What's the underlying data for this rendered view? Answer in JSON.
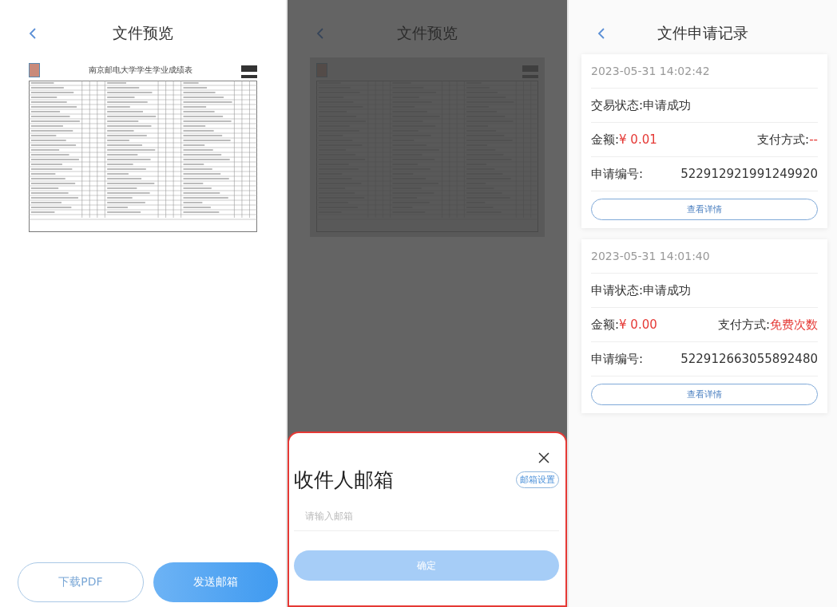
{
  "preview_screen": {
    "title": "文件预览",
    "document_title": "南京邮电大学学生学业成绩表",
    "buttons": [
      {
        "label": "下载PDF",
        "kind": "outline"
      },
      {
        "label": "发送邮箱",
        "kind": "primary"
      }
    ]
  },
  "email_screen": {
    "title": "文件预览",
    "sheet": {
      "heading": "收件人邮箱",
      "settings_label": "邮箱设置",
      "placeholder": "请输入邮箱",
      "confirm_label": "确定",
      "confirm_disabled": true,
      "highlighted": true
    }
  },
  "records_screen": {
    "title": "文件申请记录",
    "records": [
      {
        "time": "2023-05-31 14:02:42",
        "status": "交易状态:申请成功",
        "amount_label": "金额:",
        "amount": "¥ 0.01",
        "payment_label": "支付方式:",
        "payment": "--",
        "id_label": "申请编号:",
        "id": "522912921991249920",
        "details_label": "查看详情"
      },
      {
        "time": "2023-05-31 14:01:40",
        "status": "申请状态:申请成功",
        "amount_label": "金额:",
        "amount": "¥ 0.00",
        "payment_label": "支付方式:",
        "payment": "免费次数",
        "id_label": "申请编号:",
        "id": "522912663055892480",
        "details_label": "查看详情"
      }
    ]
  }
}
